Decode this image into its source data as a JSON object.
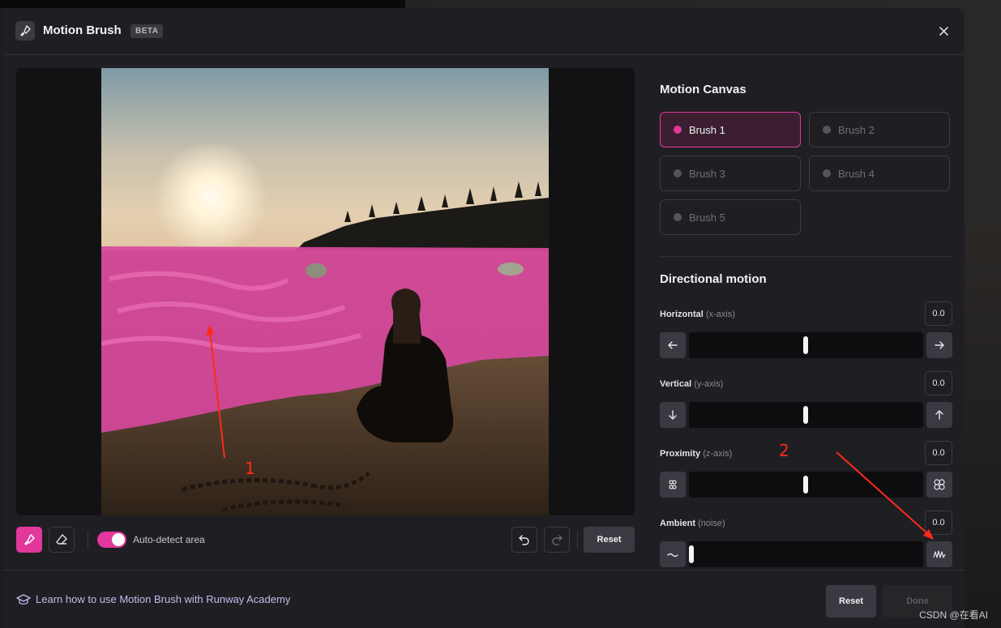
{
  "header": {
    "title": "Motion Brush",
    "badge": "BETA",
    "icon": "brush-icon"
  },
  "toolbar": {
    "auto_detect_label": "Auto-detect area",
    "auto_detect_on": true,
    "reset_label": "Reset"
  },
  "motion_canvas": {
    "title": "Motion Canvas",
    "brushes": [
      {
        "label": "Brush 1",
        "active": true
      },
      {
        "label": "Brush 2",
        "active": false
      },
      {
        "label": "Brush 3",
        "active": false
      },
      {
        "label": "Brush 4",
        "active": false
      },
      {
        "label": "Brush 5",
        "active": false
      }
    ]
  },
  "directional_motion": {
    "title": "Directional motion",
    "axes": [
      {
        "label": "Horizontal",
        "sub": "(x-axis)",
        "value": "0.0",
        "left_icon": "arrow-left-icon",
        "right_icon": "arrow-right-icon"
      },
      {
        "label": "Vertical",
        "sub": "(y-axis)",
        "value": "0.0",
        "left_icon": "arrow-down-icon",
        "right_icon": "arrow-up-icon"
      },
      {
        "label": "Proximity",
        "sub": "(z-axis)",
        "value": "0.0",
        "left_icon": "shrink-icon",
        "right_icon": "expand-icon"
      },
      {
        "label": "Ambient",
        "sub": "(noise)",
        "value": "0.0",
        "left_icon": "low-noise-icon",
        "right_icon": "high-noise-icon"
      }
    ]
  },
  "footer": {
    "learn_link": "Learn how to use Motion Brush with Runway Academy",
    "reset_label": "Reset",
    "done_label": "Done"
  },
  "annotations": {
    "one": "1",
    "two": "2",
    "color": "#ff2a1a"
  },
  "watermark": "CSDN @在看AI",
  "colors": {
    "accent": "#e2379d",
    "panel_bg": "#1f1f23",
    "button_bg": "#3a3b42"
  }
}
